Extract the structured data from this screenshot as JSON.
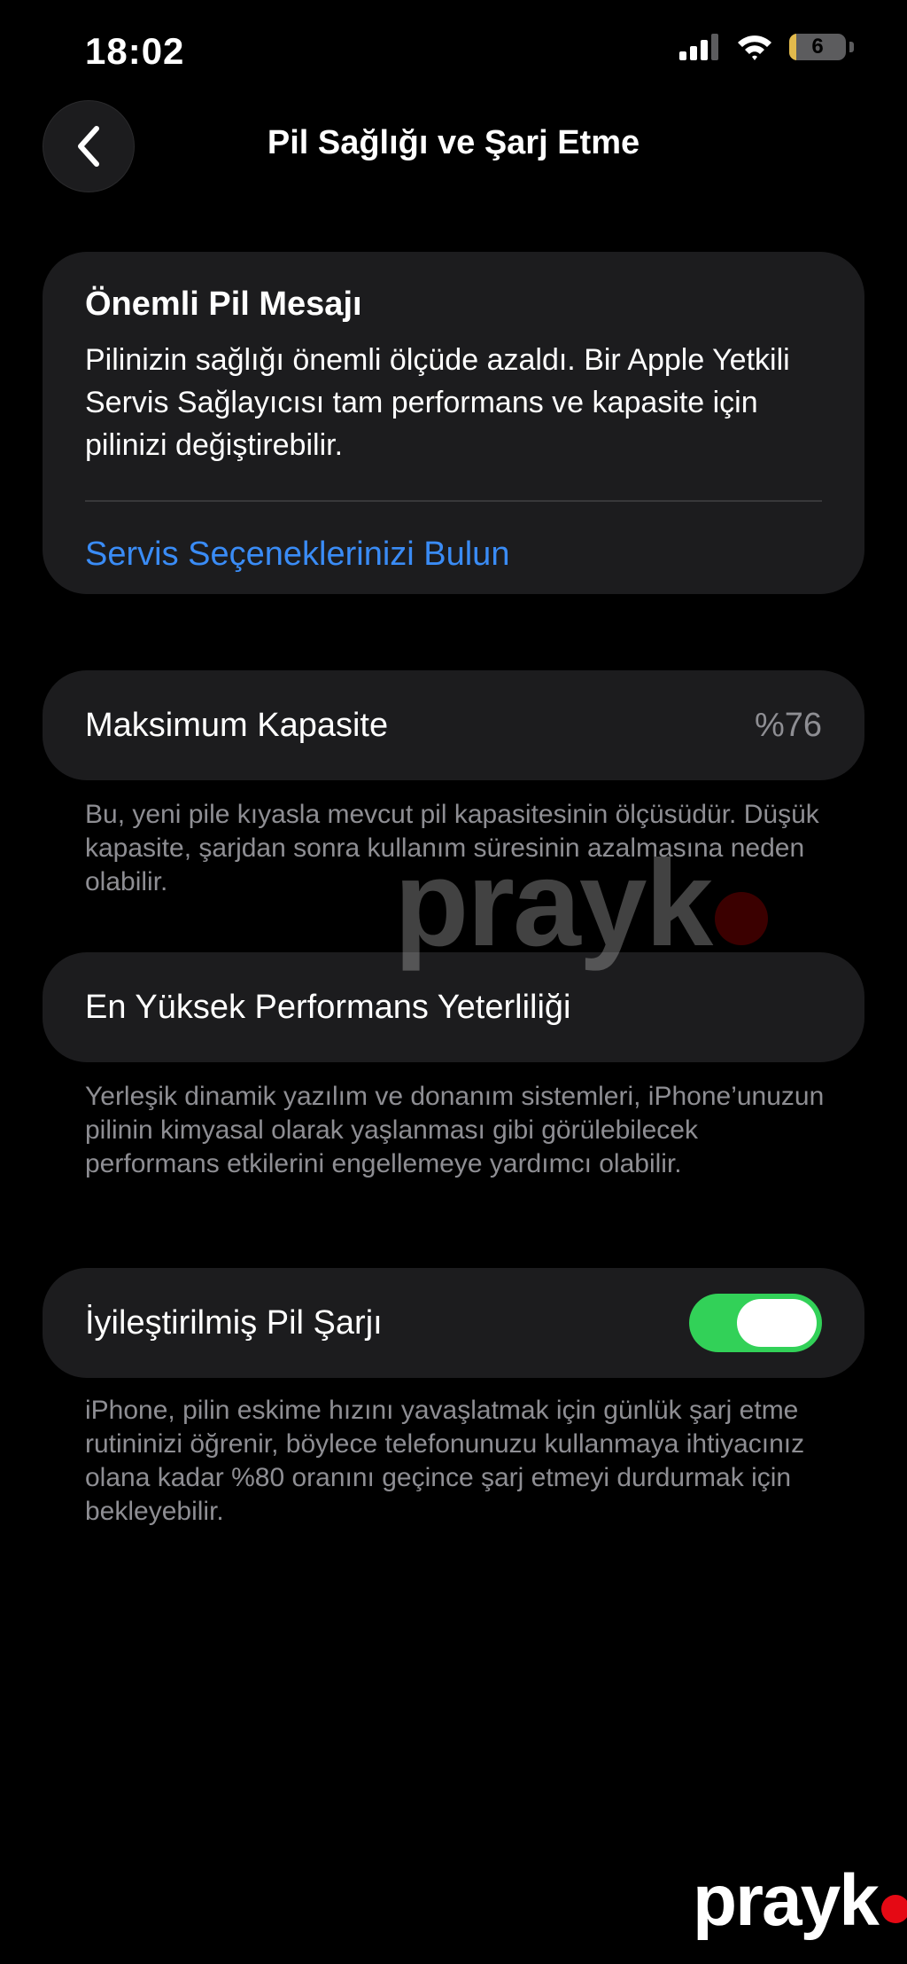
{
  "status_bar": {
    "time": "18:02",
    "battery_level": "6",
    "battery_fill_fraction": 0.12
  },
  "nav": {
    "title": "Pil Sağlığı ve Şarj Etme"
  },
  "message_card": {
    "heading": "Önemli Pil Mesajı",
    "body": "Pilinizin sağlığı önemli ölçüde azaldı. Bir Apple Yetkili Servis Sağlayıcısı tam performans ve kapasite için pilinizi değiştirebilir.",
    "link": "Servis Seçeneklerinizi Bulun"
  },
  "capacity": {
    "label": "Maksimum Kapasite",
    "value": "%76",
    "footnote": "Bu, yeni pile kıyasla mevcut pil kapasitesinin ölçüsüdür. Düşük kapasite, şarjdan sonra kullanım süresinin azalmasına neden olabilir."
  },
  "performance": {
    "label": "En Yüksek Performans Yeterliliği",
    "footnote": "Yerleşik dinamik yazılım ve donanım sistemleri, iPhone’unuzun pilinin kimyasal olarak yaşlanması gibi görülebilecek performans etkilerini engellemeye yardımcı olabilir."
  },
  "optimized": {
    "label": "İyileştirilmiş Pil Şarjı",
    "enabled": true,
    "footnote": "iPhone, pilin eskime hızını yavaşlatmak için günlük şarj etme rutininizi öğrenir, böylece telefonunuzu kullanmaya ihtiyacınız olana kadar %80 oranını geçince şarj etmeyi durdurmak için bekleyebilir."
  },
  "watermark": {
    "text": "prayk"
  },
  "logo": {
    "text": "prayk"
  },
  "colors": {
    "accent": "#3a8cf6",
    "toggle_on": "#32d158",
    "battery_fill": "#e2ba4c"
  }
}
